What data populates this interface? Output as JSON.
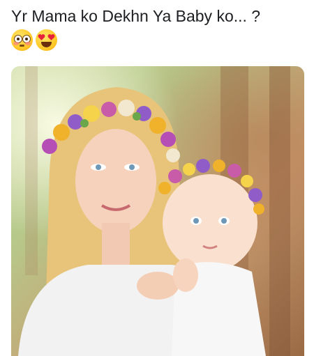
{
  "post": {
    "caption": "Yr Mama ko Dekhn Ya Baby ko... ?",
    "emojis": [
      "flushed-face-icon",
      "smiling-face-with-heart-eyes-icon"
    ]
  },
  "colors": {
    "text": "#1c1e21",
    "background": "#ffffff"
  }
}
